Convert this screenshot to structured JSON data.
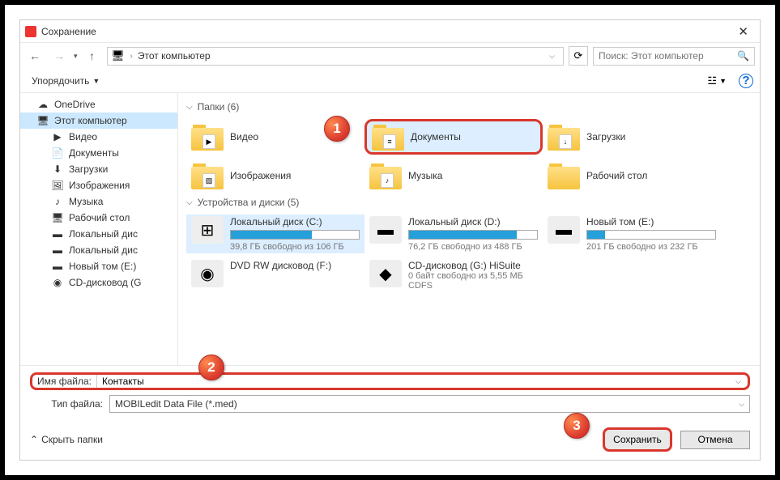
{
  "window": {
    "title": "Сохранение"
  },
  "nav": {
    "location": "Этот компьютер",
    "search_placeholder": "Поиск: Этот компьютер"
  },
  "toolbar": {
    "organize": "Упорядочить"
  },
  "sidebar": {
    "items": [
      {
        "label": "OneDrive",
        "icon": "cloud-icon"
      },
      {
        "label": "Этот компьютер",
        "icon": "pc-icon",
        "selected": true
      },
      {
        "label": "Видео",
        "icon": "video-icon",
        "lvl": 2
      },
      {
        "label": "Документы",
        "icon": "document-icon",
        "lvl": 2
      },
      {
        "label": "Загрузки",
        "icon": "download-icon",
        "lvl": 2
      },
      {
        "label": "Изображения",
        "icon": "picture-icon",
        "lvl": 2
      },
      {
        "label": "Музыка",
        "icon": "music-icon",
        "lvl": 2
      },
      {
        "label": "Рабочий стол",
        "icon": "desktop-icon",
        "lvl": 2
      },
      {
        "label": "Локальный дис",
        "icon": "drive-icon",
        "lvl": 2
      },
      {
        "label": "Локальный дис",
        "icon": "drive-icon",
        "lvl": 2
      },
      {
        "label": "Новый том (E:)",
        "icon": "drive-icon",
        "lvl": 2
      },
      {
        "label": "CD-дисковод (G",
        "icon": "cd-icon",
        "lvl": 2
      }
    ]
  },
  "content": {
    "folders_header": "Папки (6)",
    "folders": [
      {
        "name": "Видео",
        "overlay": "▶"
      },
      {
        "name": "Документы",
        "overlay": "≡",
        "selected": true,
        "highlight": true
      },
      {
        "name": "Загрузки",
        "overlay": "↓"
      },
      {
        "name": "Изображения",
        "overlay": "▨"
      },
      {
        "name": "Музыка",
        "overlay": "♪"
      },
      {
        "name": "Рабочий стол",
        "overlay": ""
      }
    ],
    "drives_header": "Устройства и диски (5)",
    "drives": [
      {
        "name": "Локальный диск (C:)",
        "sub": "39,8 ГБ свободно из 106 ГБ",
        "fill": 63,
        "selected": true,
        "icon": "⊞"
      },
      {
        "name": "Локальный диск (D:)",
        "sub": "76,2 ГБ свободно из 488 ГБ",
        "fill": 84,
        "icon": "▬"
      },
      {
        "name": "Новый том (E:)",
        "sub": "201 ГБ свободно из 232 ГБ",
        "fill": 14,
        "icon": "▬"
      },
      {
        "name": "DVD RW дисковод (F:)",
        "sub": "",
        "fill": -1,
        "icon": "◉"
      },
      {
        "name": "CD-дисковод (G:) HiSuite",
        "sub": "0 байт свободно из 5,55 МБ",
        "sub2": "CDFS",
        "fill": -1,
        "icon": "◆"
      }
    ]
  },
  "bottom": {
    "filename_label": "Имя файла:",
    "filename_value": "Контакты",
    "filetype_label": "Тип файла:",
    "filetype_value": "MOBILedit Data File (*.med)"
  },
  "footer": {
    "hide_folders": "Скрыть папки",
    "save": "Сохранить",
    "cancel": "Отмена"
  },
  "badges": {
    "b1": "1",
    "b2": "2",
    "b3": "3"
  }
}
